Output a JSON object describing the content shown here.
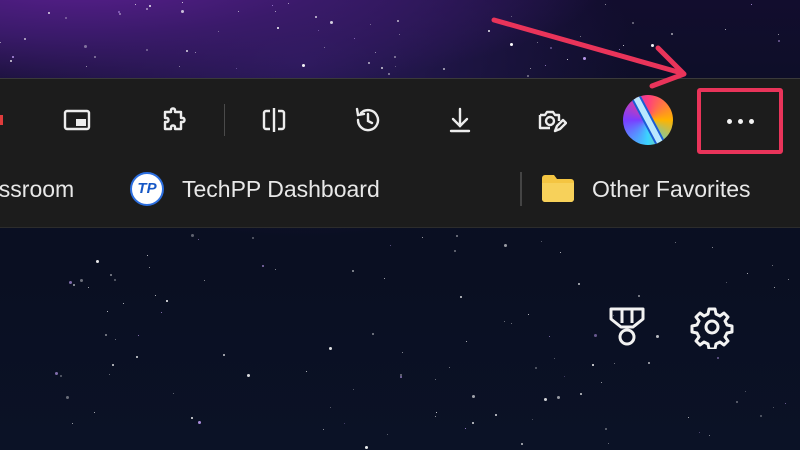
{
  "toolbar": {
    "buttons": [
      {
        "name": "split-screen-icon"
      },
      {
        "name": "extensions-icon"
      },
      {
        "name": "split-view-icon"
      },
      {
        "name": "history-icon"
      },
      {
        "name": "downloads-icon"
      },
      {
        "name": "screenshot-icon"
      }
    ],
    "profile_avatar": "profile-avatar",
    "more_button": {
      "label": "···",
      "highlight_color": "#e9345a"
    }
  },
  "favorites_bar": {
    "items": [
      {
        "label": "assroom"
      },
      {
        "label": "TechPP Dashboard",
        "icon_text": "TP"
      },
      {
        "label": "Other Favorites",
        "icon": "folder-icon"
      }
    ]
  },
  "page": {
    "icons": [
      "rewards-medal-icon",
      "settings-gear-icon"
    ]
  },
  "colors": {
    "toolbar_bg": "#1c1c1c",
    "annotation": "#e9345a",
    "folder": "#f4c542"
  }
}
